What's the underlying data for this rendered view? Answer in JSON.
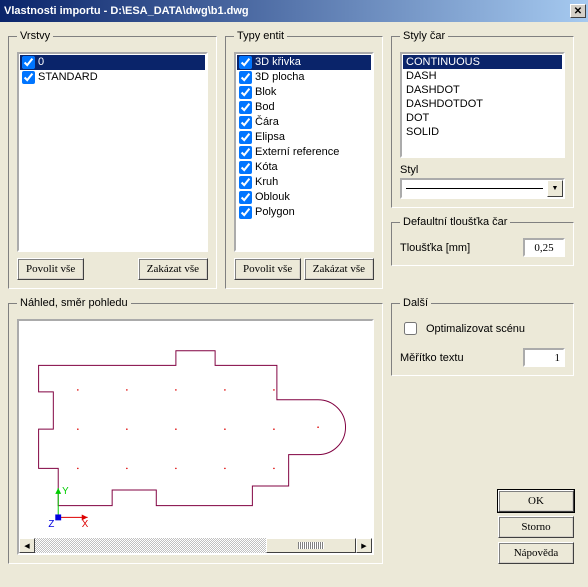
{
  "title": "Vlastnosti importu - D:\\ESA_DATA\\dwg\\b1.dwg",
  "groups": {
    "vrstvy": "Vrstvy",
    "typy": "Typy entit",
    "styly": "Styly čar",
    "styl": "Styl",
    "tloustka": "Defaultní tloušťka čar",
    "nahled": "Náhled, směr pohledu",
    "dalsi": "Další"
  },
  "vrstvy": {
    "items": [
      {
        "label": "0",
        "checked": true,
        "selected": true
      },
      {
        "label": "STANDARD",
        "checked": true,
        "selected": false
      }
    ]
  },
  "buttons": {
    "povolit": "Povolit vše",
    "zakazat": "Zakázat vše",
    "ok": "OK",
    "storno": "Storno",
    "napoveda": "Nápověda"
  },
  "typy": {
    "items": [
      {
        "label": "3D křivka",
        "checked": true,
        "selected": true
      },
      {
        "label": "3D plocha",
        "checked": true
      },
      {
        "label": "Blok",
        "checked": true
      },
      {
        "label": "Bod",
        "checked": true
      },
      {
        "label": "Čára",
        "checked": true
      },
      {
        "label": "Elipsa",
        "checked": true
      },
      {
        "label": "Externí reference",
        "checked": true
      },
      {
        "label": "Kóta",
        "checked": true
      },
      {
        "label": "Kruh",
        "checked": true
      },
      {
        "label": "Oblouk",
        "checked": true
      },
      {
        "label": "Polygon",
        "checked": true
      }
    ]
  },
  "styly": {
    "items": [
      {
        "label": "CONTINUOUS",
        "selected": true
      },
      {
        "label": "DASH"
      },
      {
        "label": "DASHDOT"
      },
      {
        "label": "DASHDOTDOT"
      },
      {
        "label": "DOT"
      },
      {
        "label": "SOLID"
      }
    ]
  },
  "tloustka": {
    "label": "Tloušťka [mm]",
    "value": "0,25"
  },
  "dalsi": {
    "opt_label": "Optimalizovat scénu",
    "opt_checked": false,
    "meritko_label": "Měřítko textu",
    "meritko_value": "1"
  },
  "axes": {
    "x": "X",
    "y": "Y",
    "z": "Z"
  }
}
